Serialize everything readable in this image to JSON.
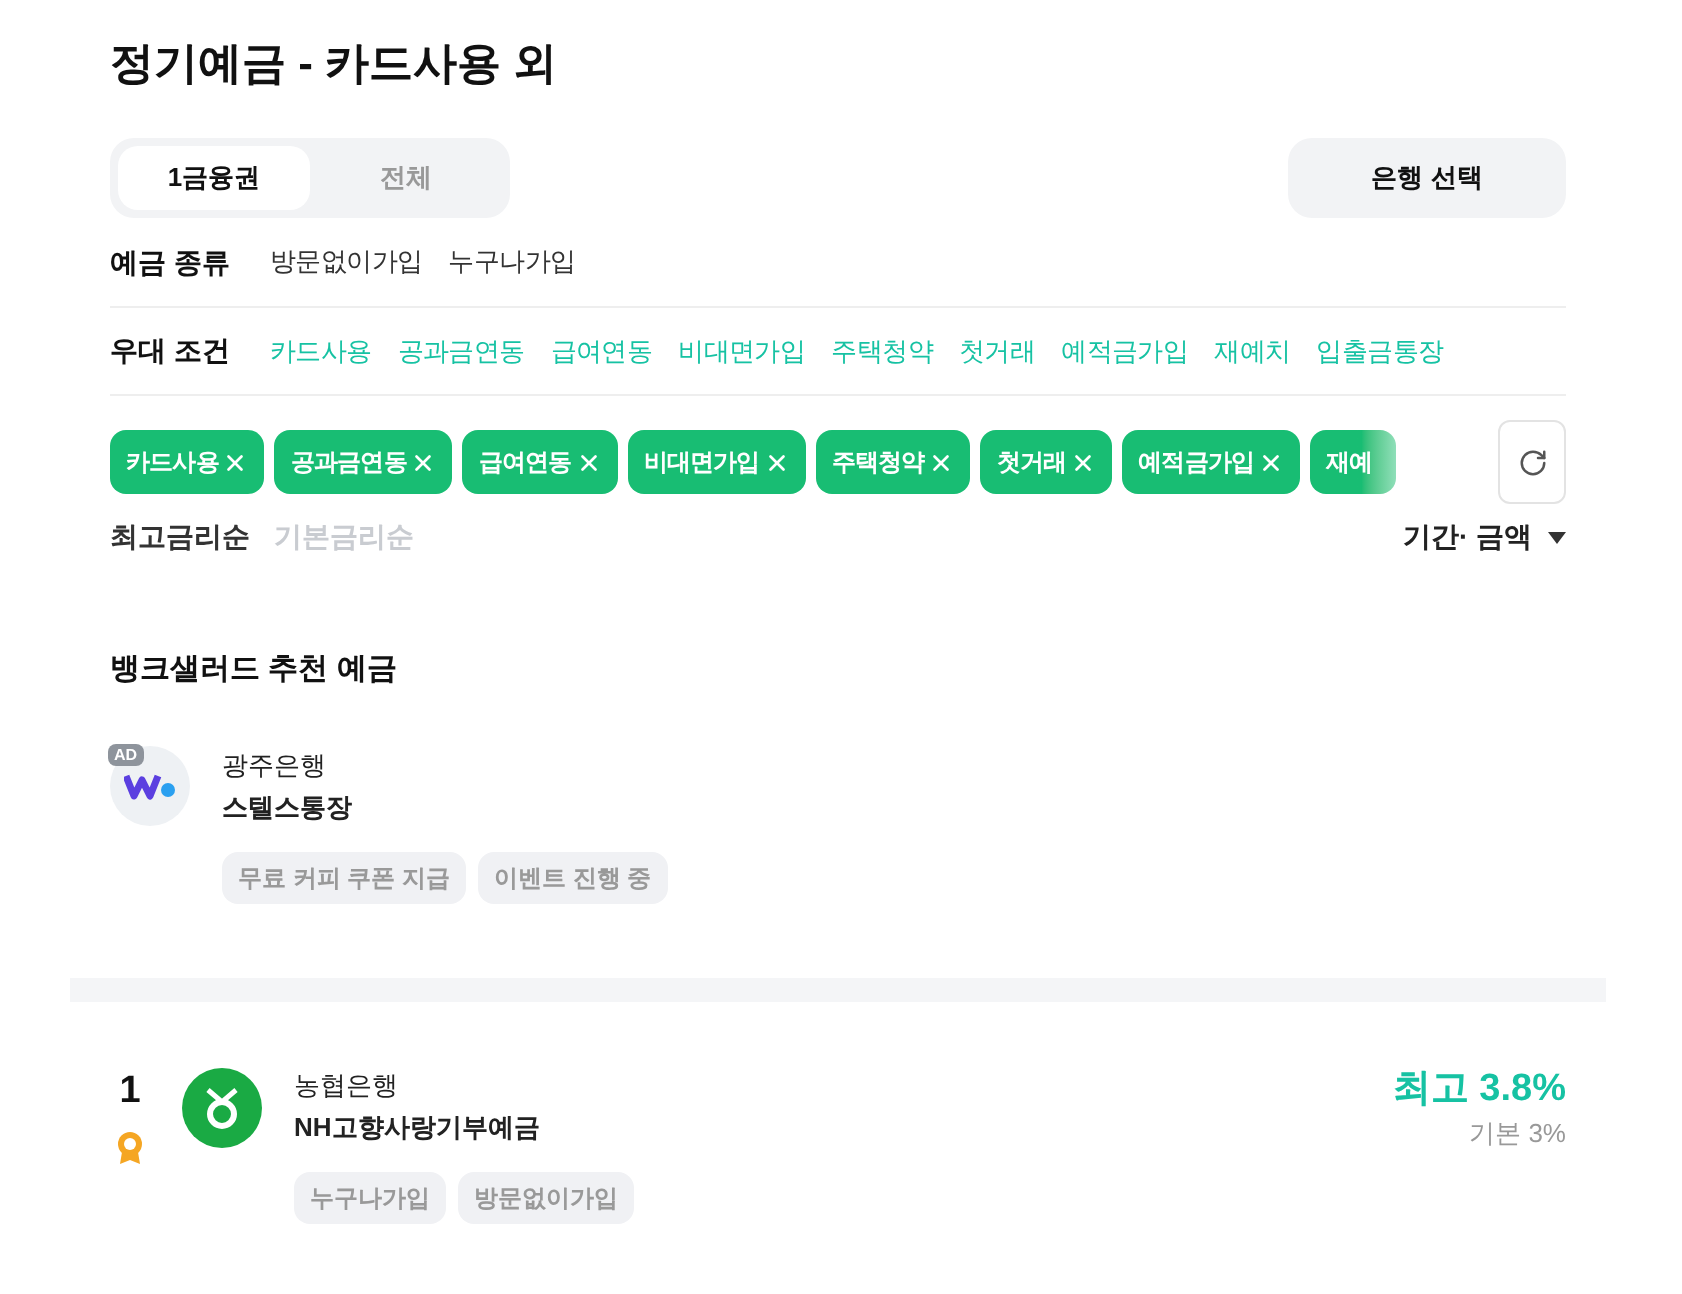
{
  "title": "정기예금 - 카드사용 외",
  "segments": [
    {
      "label": "1금융권",
      "selected": true
    },
    {
      "label": "전체",
      "selected": false
    }
  ],
  "bank_select_button": "은행 선택",
  "filter_rows": [
    {
      "label": "예금 종류",
      "kind": "plain",
      "options": [
        "방문없이가입",
        "누구나가입"
      ]
    },
    {
      "label": "우대 조건",
      "kind": "accent",
      "options": [
        "카드사용",
        "공과금연동",
        "급여연동",
        "비대면가입",
        "주택청약",
        "첫거래",
        "예적금가입",
        "재예치",
        "입출금통장"
      ]
    }
  ],
  "chips": [
    {
      "label": "카드사용",
      "truncated": false
    },
    {
      "label": "공과금연동",
      "truncated": false
    },
    {
      "label": "급여연동",
      "truncated": false
    },
    {
      "label": "비대면가입",
      "truncated": false
    },
    {
      "label": "주택청약",
      "truncated": false
    },
    {
      "label": "첫거래",
      "truncated": false
    },
    {
      "label": "예적금가입",
      "truncated": false
    },
    {
      "label": "재예",
      "truncated": true
    }
  ],
  "sort_options": [
    {
      "label": "최고금리순",
      "selected": true
    },
    {
      "label": "기본금리순",
      "selected": false
    }
  ],
  "period_filter": "기간· 금액",
  "ad_section": {
    "title": "뱅크샐러드 추천 예금",
    "badge": "AD",
    "bank": "광주은행",
    "product": "스텔스통장",
    "tags": [
      "무료 커피 쿠폰 지급",
      "이벤트 진행 중"
    ]
  },
  "products": [
    {
      "rank": "1",
      "bank": "농협은행",
      "product": "NH고향사랑기부예금",
      "max_rate": "최고 3.8%",
      "base_rate": "기본 3%",
      "tags": [
        "누구나가입",
        "방문없이가입"
      ]
    }
  ]
}
